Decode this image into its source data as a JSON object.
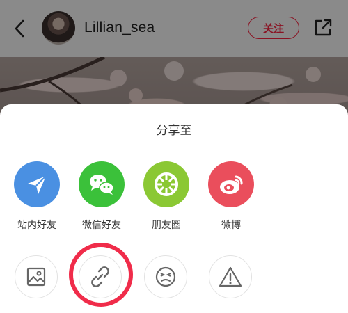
{
  "header": {
    "username": "Lillian_sea",
    "follow_label": "关注"
  },
  "share_sheet": {
    "title": "分享至",
    "targets": [
      {
        "label": "站内好友",
        "icon": "paper-plane-icon",
        "color": "#4a90e2"
      },
      {
        "label": "微信好友",
        "icon": "wechat-icon",
        "color": "#3bc13a"
      },
      {
        "label": "朋友圈",
        "icon": "wechat-moments-icon",
        "color": "#8bc834"
      },
      {
        "label": "微博",
        "icon": "weibo-icon",
        "color": "#ea4e5c"
      }
    ],
    "tools": [
      {
        "icon": "image-icon"
      },
      {
        "icon": "link-icon"
      },
      {
        "icon": "dislike-face-icon"
      },
      {
        "icon": "warning-icon"
      }
    ]
  },
  "colors": {
    "accent": "#ff2442",
    "highlight_ring": "#f02c4a"
  }
}
